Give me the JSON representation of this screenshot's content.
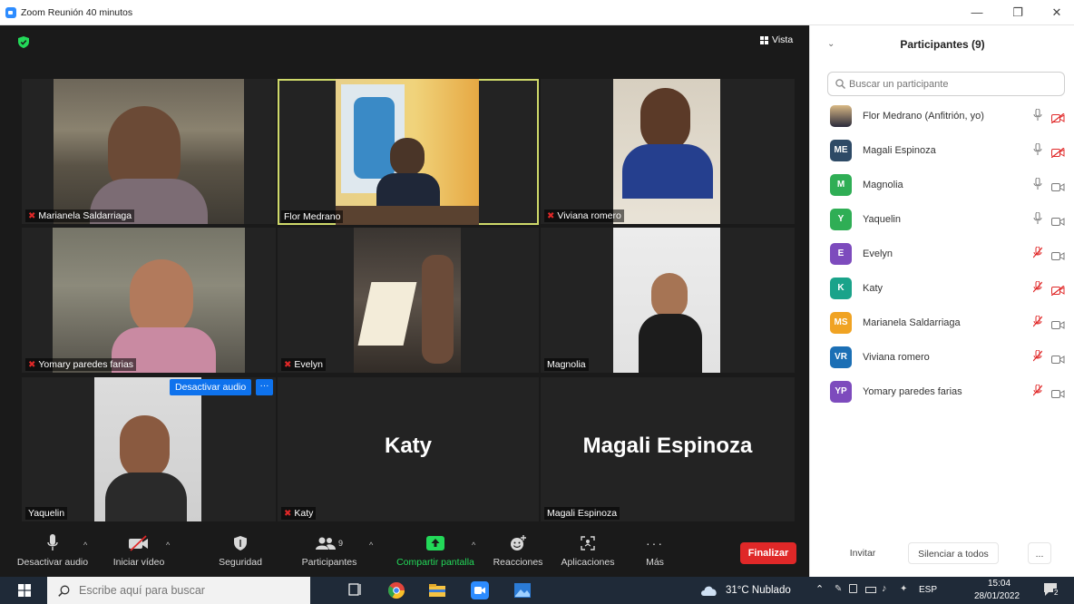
{
  "window": {
    "title": "Zoom Reunión 40 minutos",
    "controls": [
      "minimize-icon",
      "restore-icon",
      "close-icon"
    ]
  },
  "meeting": {
    "view_label": "Vista",
    "tiles": [
      {
        "name": "Marianela Saldarriaga",
        "muted": true,
        "video": true,
        "active": false
      },
      {
        "name": "Flor Medrano",
        "muted": false,
        "video": true,
        "active": true
      },
      {
        "name": "Viviana romero",
        "muted": true,
        "video": true,
        "active": false
      },
      {
        "name": "Yomary paredes farias",
        "muted": true,
        "video": true,
        "active": false
      },
      {
        "name": "Evelyn",
        "muted": true,
        "video": true,
        "active": false
      },
      {
        "name": "Magnolia",
        "muted": false,
        "video": true,
        "active": false
      },
      {
        "name": "Yaquelin",
        "muted": false,
        "video": true,
        "active": false
      },
      {
        "name": "Katy",
        "muted": true,
        "video": false,
        "active": false
      },
      {
        "name": "Magali Espinoza",
        "muted": false,
        "video": false,
        "active": false
      }
    ],
    "hover_mute_label": "Desactivar audio",
    "hover_more_label": "···"
  },
  "toolbar": {
    "audio": "Desactivar audio",
    "video": "Iniciar vídeo",
    "security": "Seguridad",
    "participants": "Participantes",
    "participants_count": "9",
    "share": "Compartir pantalla",
    "reactions": "Reacciones",
    "apps": "Aplicaciones",
    "more": "Más",
    "end": "Finalizar"
  },
  "panel": {
    "title": "Participantes (9)",
    "search_placeholder": "Buscar un participante",
    "participants": [
      {
        "name": "Flor Medrano (Anfitrión, yo)",
        "initials": "",
        "color": "#c9a46a",
        "mic_muted": false,
        "video_off": true
      },
      {
        "name": "Magali Espinoza",
        "initials": "ME",
        "color": "#2e4a66",
        "mic_muted": false,
        "video_off": true
      },
      {
        "name": "Magnolia",
        "initials": "M",
        "color": "#2fae55",
        "mic_muted": false,
        "video_off": false
      },
      {
        "name": "Yaquelin",
        "initials": "Y",
        "color": "#2fae55",
        "mic_muted": false,
        "video_off": false
      },
      {
        "name": "Evelyn",
        "initials": "E",
        "color": "#7d4bbd",
        "mic_muted": true,
        "video_off": false
      },
      {
        "name": "Katy",
        "initials": "K",
        "color": "#1aa38a",
        "mic_muted": true,
        "video_off": true
      },
      {
        "name": "Marianela Saldarriaga",
        "initials": "MS",
        "color": "#f0a323",
        "mic_muted": true,
        "video_off": false
      },
      {
        "name": "Viviana romero",
        "initials": "VR",
        "color": "#1b6fb5",
        "mic_muted": true,
        "video_off": false
      },
      {
        "name": "Yomary paredes farias",
        "initials": "YP",
        "color": "#7d4bbd",
        "mic_muted": true,
        "video_off": false
      }
    ],
    "invite": "Invitar",
    "mute_all": "Silenciar a todos",
    "more": "..."
  },
  "taskbar": {
    "search_placeholder": "Escribe aquí para buscar",
    "weather": "31°C Nublado",
    "lang": "ESP",
    "time": "15:04",
    "date": "28/01/2022",
    "notifications": "2"
  }
}
